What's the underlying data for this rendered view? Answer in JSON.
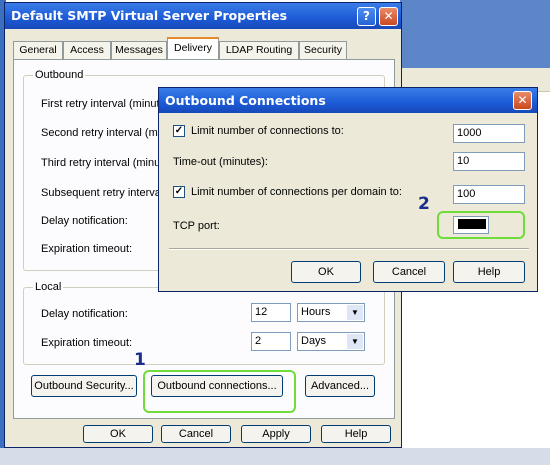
{
  "main_dialog": {
    "title": "Default SMTP Virtual Server Properties",
    "tabs": [
      "General",
      "Access",
      "Messages",
      "Delivery",
      "LDAP Routing",
      "Security"
    ],
    "active_tab": "Delivery",
    "outbound": {
      "group_label": "Outbound",
      "first_retry": "First retry interval (minute",
      "second_retry": "Second retry interval (min",
      "third_retry": "Third retry interval (minute",
      "subsequent_retry": "Subsequent retry interval",
      "delay_notification": "Delay notification:",
      "expiration_timeout": "Expiration timeout:"
    },
    "local": {
      "group_label": "Local",
      "delay_notification": "Delay notification:",
      "delay_value": "12",
      "delay_unit": "Hours",
      "expiration_timeout": "Expiration timeout:",
      "expiration_value": "2",
      "expiration_unit": "Days"
    },
    "buttons": {
      "outbound_security": "Outbound Security...",
      "outbound_connections": "Outbound connections...",
      "advanced": "Advanced...",
      "ok": "OK",
      "cancel": "Cancel",
      "apply": "Apply",
      "help": "Help"
    }
  },
  "connections_dialog": {
    "title": "Outbound Connections",
    "limit_connections_label": "Limit number of connections to:",
    "limit_connections_checked": true,
    "limit_connections_value": "1000",
    "timeout_label": "Time-out (minutes):",
    "timeout_value": "10",
    "limit_per_domain_label": "Limit number of connections per domain to:",
    "limit_per_domain_checked": true,
    "limit_per_domain_value": "100",
    "tcp_port_label": "TCP port:",
    "buttons": {
      "ok": "OK",
      "cancel": "Cancel",
      "help": "Help"
    }
  },
  "annotations": {
    "step1": "1",
    "step2": "2",
    "highlight_color": "#6fdc3c",
    "number_color": "#1c2c8c"
  }
}
